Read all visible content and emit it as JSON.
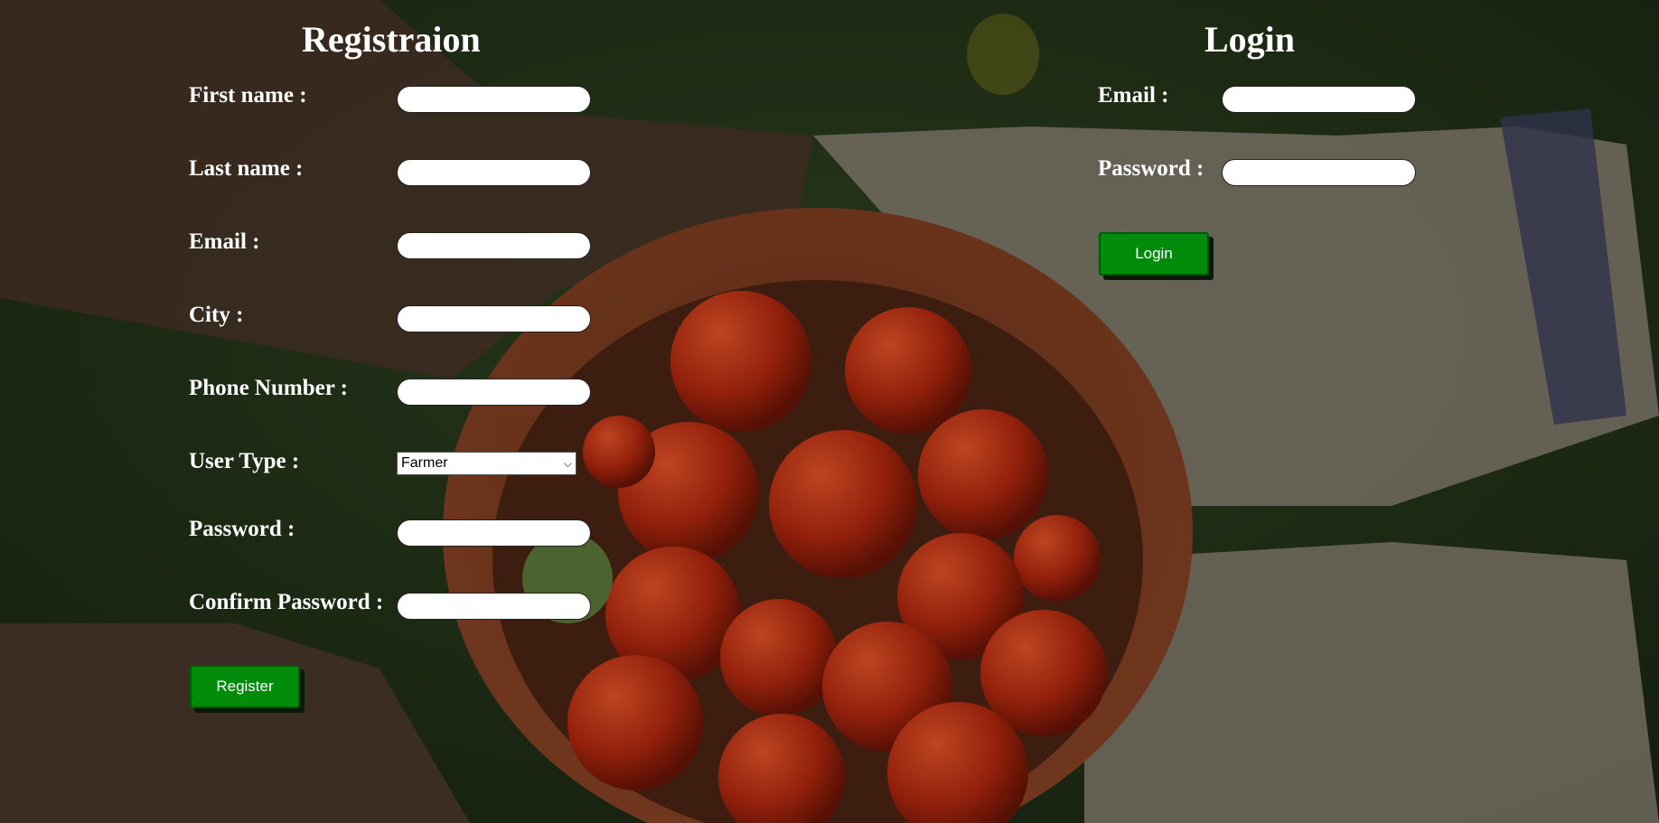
{
  "registration": {
    "title": "Registraion",
    "first_name_label": "First name :",
    "last_name_label": "Last name :",
    "email_label": "Email :",
    "city_label": "City :",
    "phone_label": "Phone Number :",
    "user_type_label": "User Type :",
    "user_type_value": "Farmer",
    "password_label": "Password :",
    "confirm_password_label": "Confirm Password :",
    "register_button": "Register"
  },
  "login": {
    "title": "Login",
    "email_label": "Email :",
    "password_label": "Password :",
    "login_button": "Login"
  },
  "icons": {
    "dropdown": "chevron-down-icon"
  }
}
